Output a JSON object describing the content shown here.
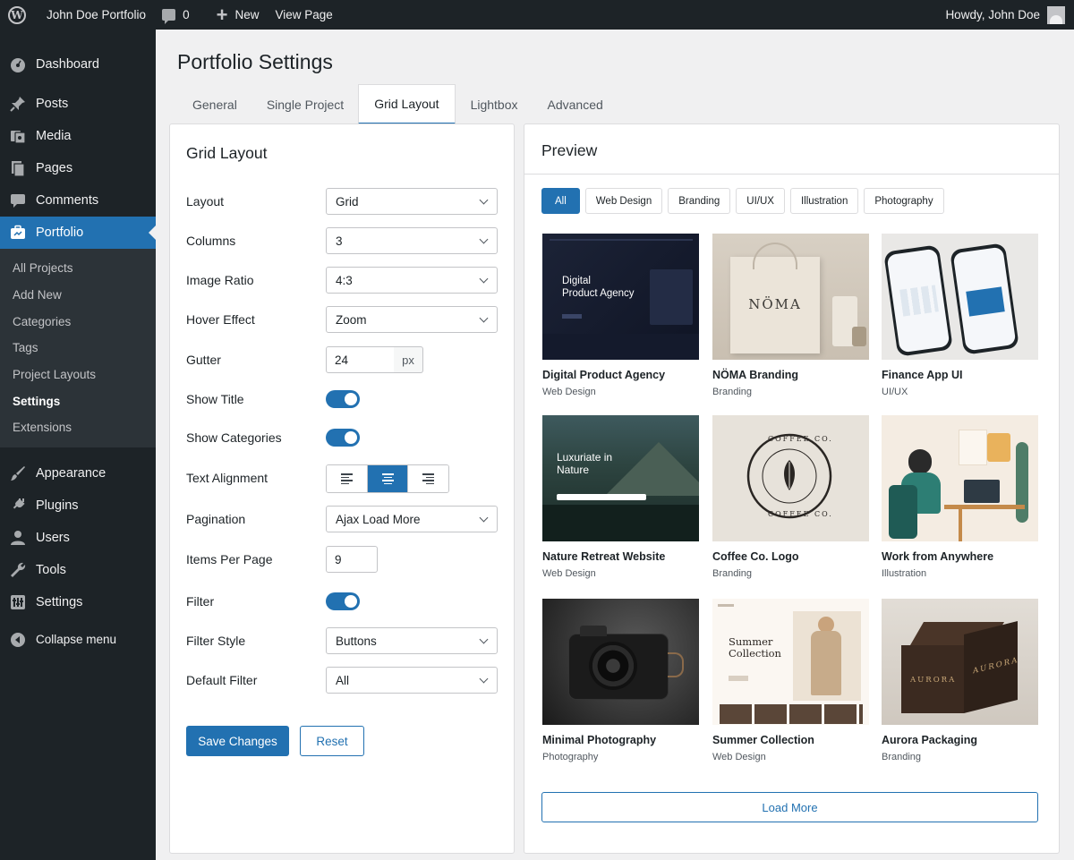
{
  "admin_bar": {
    "site_name": "John Doe Portfolio",
    "comments_count": "0",
    "new_label": "New",
    "view_page_label": "View Page",
    "howdy": "Howdy, John Doe"
  },
  "sidebar": {
    "items_top": [
      {
        "label": "Dashboard",
        "icon": "dashboard-icon"
      },
      {
        "label": "Posts",
        "icon": "pin-icon"
      },
      {
        "label": "Media",
        "icon": "media-icon"
      },
      {
        "label": "Pages",
        "icon": "pages-icon"
      },
      {
        "label": "Comments",
        "icon": "comment-icon"
      },
      {
        "label": "Portfolio",
        "icon": "portfolio-icon"
      }
    ],
    "submenu": [
      "All Projects",
      "Add New",
      "Categories",
      "Tags",
      "Project Layouts",
      "Settings",
      "Extensions"
    ],
    "current_submenu": "Settings",
    "items_bottom": [
      {
        "label": "Appearance",
        "icon": "brush-icon"
      },
      {
        "label": "Plugins",
        "icon": "plug-icon"
      },
      {
        "label": "Users",
        "icon": "user-icon"
      },
      {
        "label": "Tools",
        "icon": "wrench-icon"
      },
      {
        "label": "Settings",
        "icon": "settings-icon"
      }
    ],
    "collapse_label": "Collapse menu"
  },
  "page_title": "Portfolio Settings",
  "tabs": [
    "General",
    "Single Project",
    "Grid Layout",
    "Lightbox",
    "Advanced"
  ],
  "active_tab": "Grid Layout",
  "settings": {
    "title": "Grid Layout",
    "layout": {
      "label": "Layout",
      "value": "Grid"
    },
    "columns": {
      "label": "Columns",
      "value": "3"
    },
    "image_ratio": {
      "label": "Image Ratio",
      "value": "4:3"
    },
    "hover_effect": {
      "label": "Hover Effect",
      "value": "Zoom"
    },
    "gutter": {
      "label": "Gutter",
      "value": "24",
      "unit": "px"
    },
    "show_title": {
      "label": "Show Title",
      "on": true
    },
    "show_categories": {
      "label": "Show Categories",
      "on": true
    },
    "text_alignment": {
      "label": "Text Alignment",
      "value": "center"
    },
    "pagination": {
      "label": "Pagination",
      "value": "Ajax Load More"
    },
    "items_per_page": {
      "label": "Items Per Page",
      "value": "9"
    },
    "filter": {
      "label": "Filter",
      "on": true
    },
    "filter_style": {
      "label": "Filter Style",
      "value": "Buttons"
    },
    "default_filter": {
      "label": "Default Filter",
      "value": "All"
    },
    "save_label": "Save Changes",
    "reset_label": "Reset"
  },
  "preview": {
    "title": "Preview",
    "filters": [
      "All",
      "Web Design",
      "Branding",
      "UI/UX",
      "Illustration",
      "Photography"
    ],
    "active_filter": "All",
    "items": [
      {
        "title": "Digital Product Agency",
        "category": "Web Design",
        "thumb_text": [
          "Digital",
          "Product Agency"
        ]
      },
      {
        "title": "NÖMA Branding",
        "category": "Branding",
        "thumb_text": [
          "NÖMA"
        ]
      },
      {
        "title": "Finance App UI",
        "category": "UI/UX",
        "thumb_text": []
      },
      {
        "title": "Nature Retreat Website",
        "category": "Web Design",
        "thumb_text": [
          "Luxuriate in",
          "Nature"
        ]
      },
      {
        "title": "Coffee Co. Logo",
        "category": "Branding",
        "thumb_text": [
          "COFFEE CO.",
          "COFFEE CO."
        ]
      },
      {
        "title": "Work from Anywhere",
        "category": "Illustration",
        "thumb_text": []
      },
      {
        "title": "Minimal Photography",
        "category": "Photography",
        "thumb_text": []
      },
      {
        "title": "Summer Collection",
        "category": "Web Design",
        "thumb_text": [
          "Summer",
          "Collection"
        ]
      },
      {
        "title": "Aurora Packaging",
        "category": "Branding",
        "thumb_text": [
          "AURORA",
          "AURORA"
        ]
      }
    ],
    "load_more_label": "Load More"
  },
  "colors": {
    "accent": "#2271b1",
    "sidebar_bg": "#1d2327",
    "submenu_bg": "#2c3338",
    "page_bg": "#f0f0f1"
  }
}
